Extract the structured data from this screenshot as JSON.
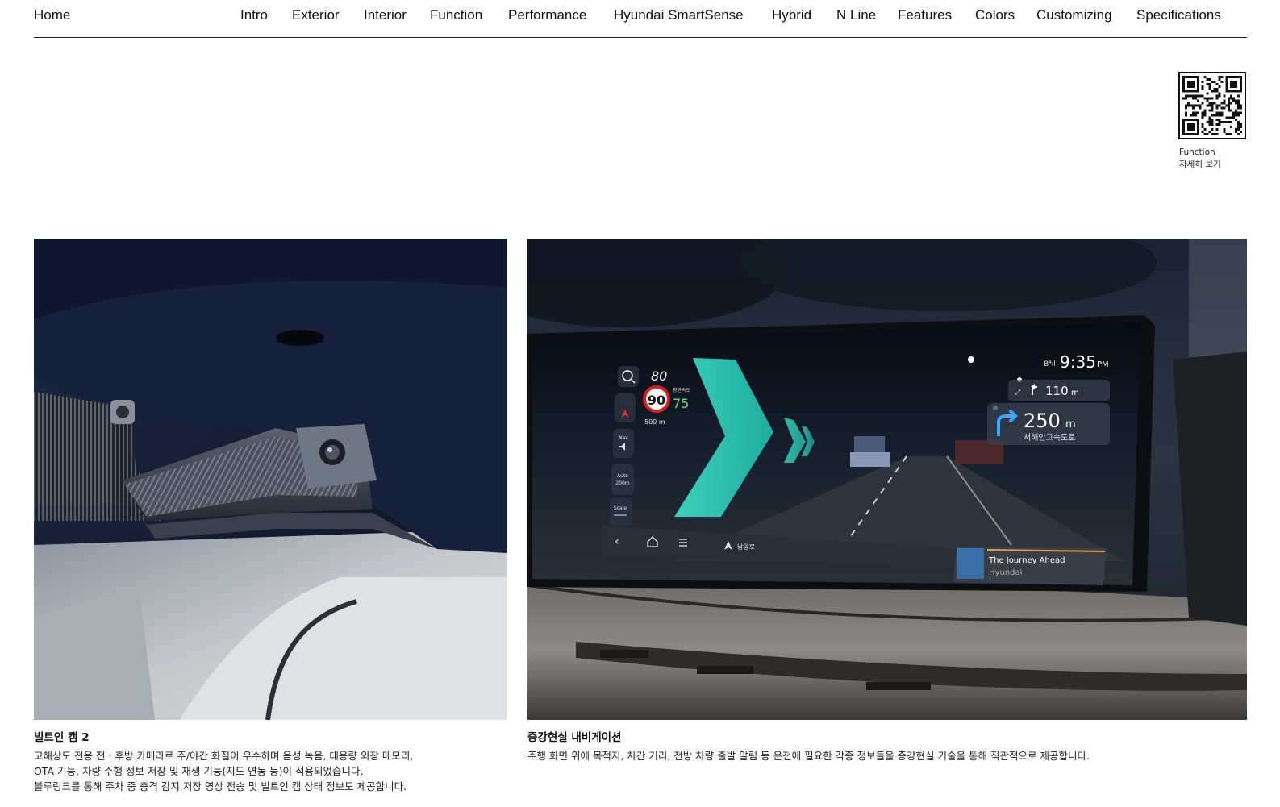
{
  "nav": {
    "home": "Home",
    "items": [
      "Intro",
      "Exterior",
      "Interior",
      "Function",
      "Performance",
      "Hyundai SmartSense",
      "Hybrid",
      "N Line",
      "Features",
      "Colors",
      "Customizing",
      "Specifications"
    ]
  },
  "qr": {
    "line1": "Function",
    "line2": "자세히 보기"
  },
  "features": [
    {
      "title": "빌트인 캠 2",
      "lines": [
        "고해상도 전용 전 · 후방 카메라로 주/야간 화질이 우수하며 음성 녹음, 대용량 외장 메모리,",
        "OTA 기능, 차량 주행 정보 저장 및 재생 기능(지도 연동 등)이 적용되었습니다.",
        "블루링크를 통해 주차 중 충격 감지 저장 영상 전송 및 빌트인 캠 상태 정보도 제공합니다."
      ]
    },
    {
      "title": "증강현실 내비게이션",
      "lines": [
        "주행 화면 위에 목적지, 차간 거리, 전방 차량 출발 알림 등 운전에 필요한 각종 정보들을 증강현실 기술을 통해 직관적으로 제공합니다."
      ]
    }
  ],
  "screen": {
    "speed": "80",
    "limit": "90",
    "avg_label": "평균속도",
    "avg": "75",
    "dist": "500 m",
    "nav_label": "Nav",
    "auto_label": "Auto",
    "auto_dist": "200m",
    "scale_label": "Scale",
    "time": "9:35",
    "ampm": "PM",
    "next_turn": "110",
    "next_turn_unit": "m",
    "turn_dist": "250",
    "turn_unit": "m",
    "road": "서해안고속도로",
    "location": "남양로",
    "song_title": "The Journey Ahead",
    "song_artist": "Hyundai"
  }
}
